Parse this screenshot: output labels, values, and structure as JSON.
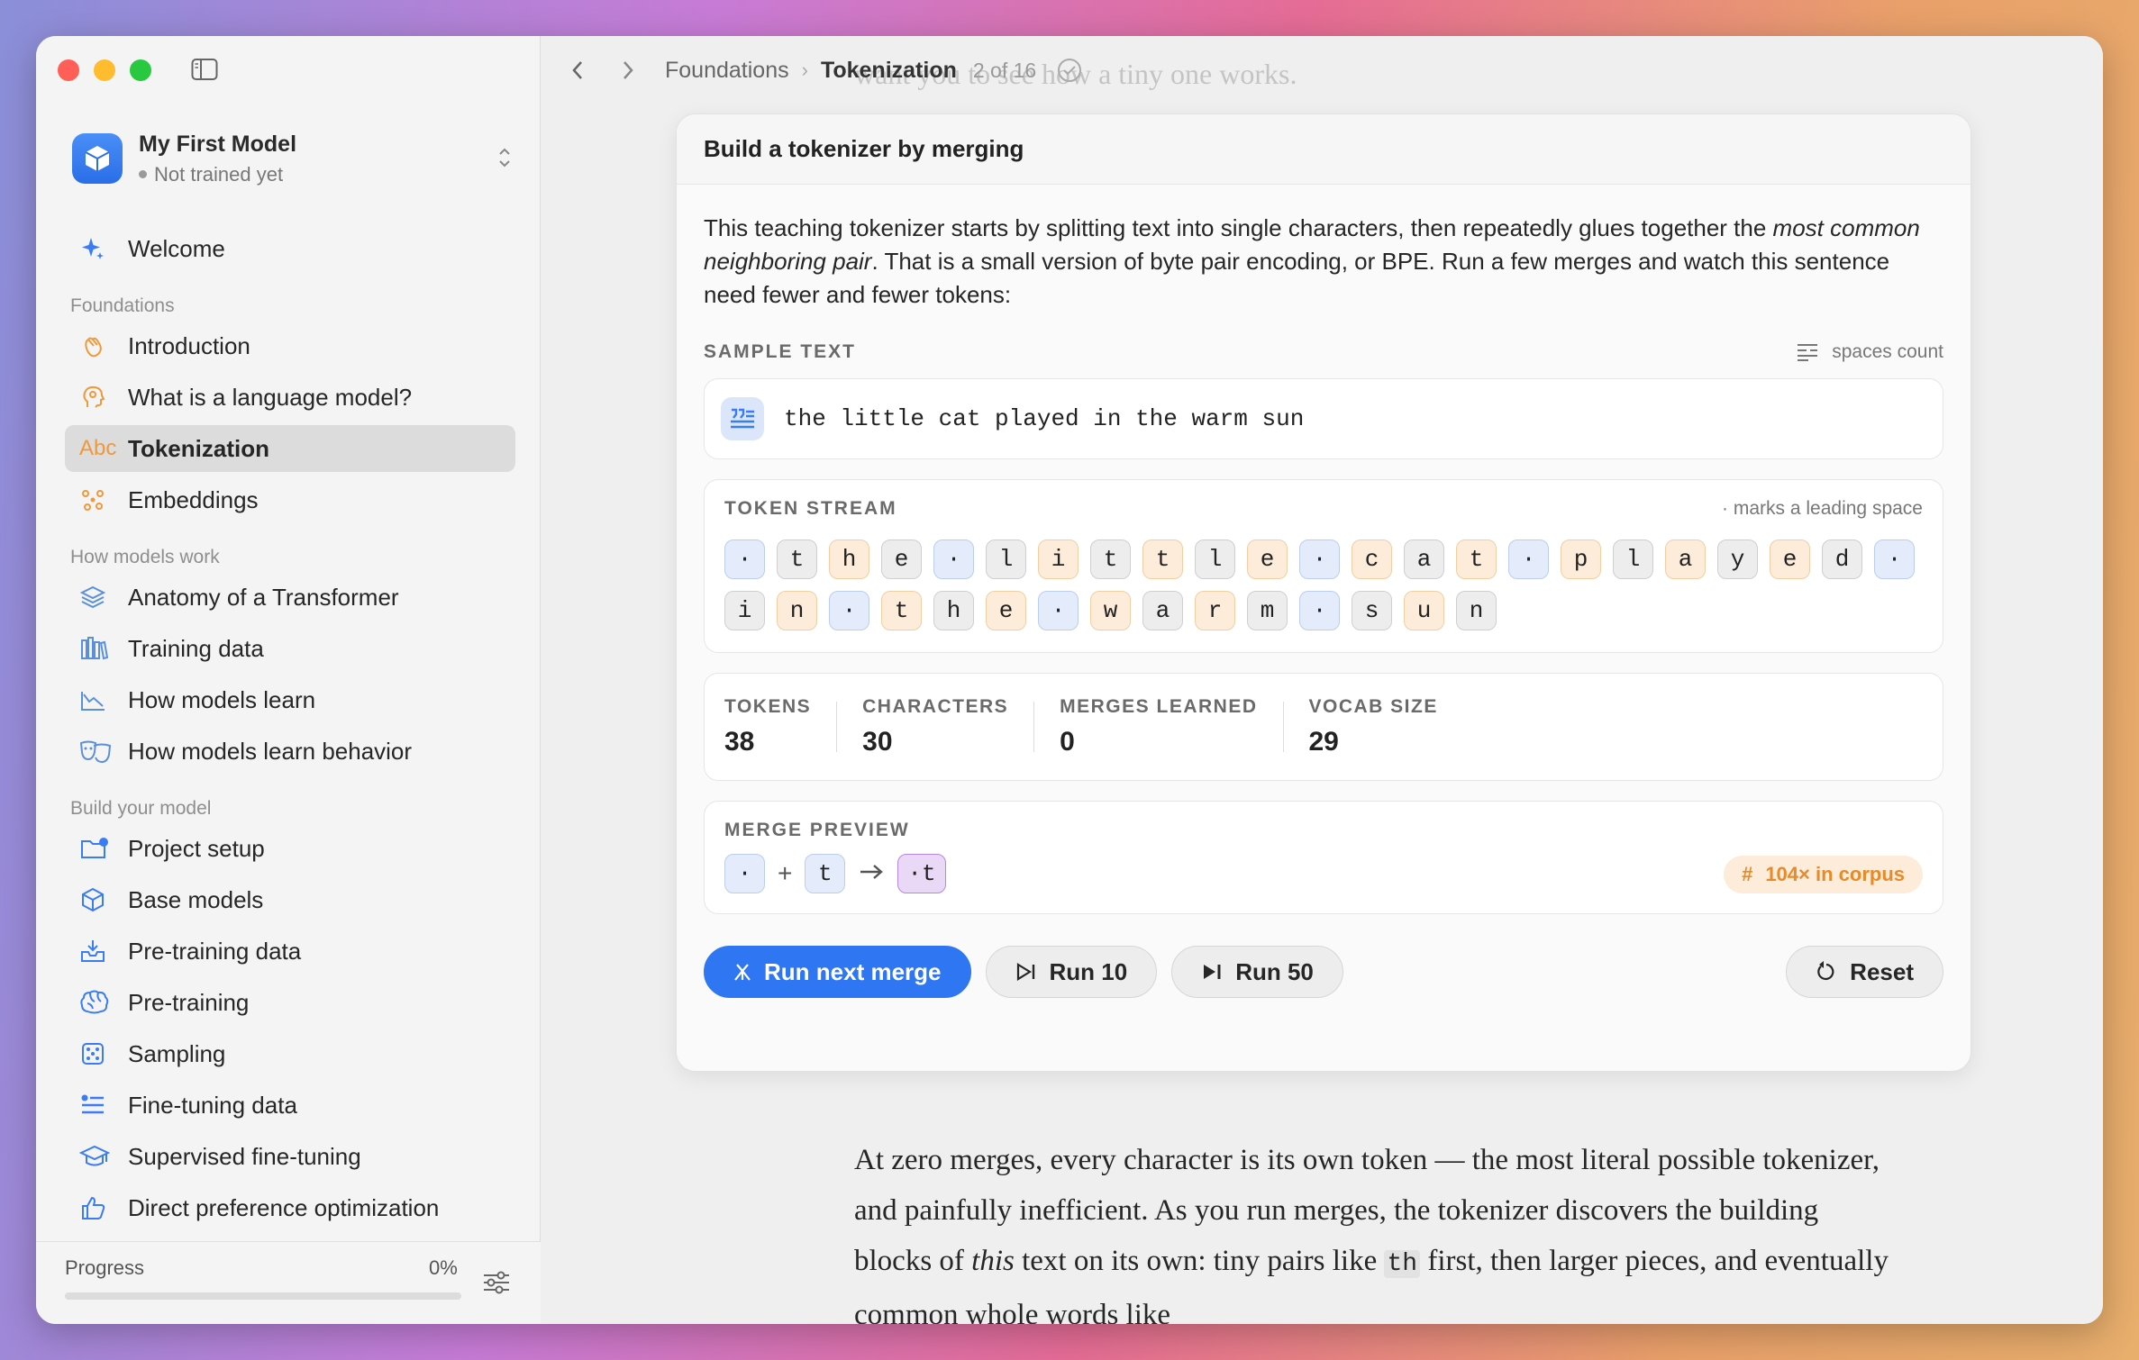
{
  "project": {
    "name": "My First Model",
    "status": "Not trained yet"
  },
  "sidebar": {
    "welcome": "Welcome",
    "sections": [
      {
        "label": "Foundations",
        "items": [
          {
            "label": "Introduction",
            "icon": "wave-hand-icon"
          },
          {
            "label": "What is a language model?",
            "icon": "head-icon"
          },
          {
            "label": "Tokenization",
            "icon": "abc-icon",
            "active": true
          },
          {
            "label": "Embeddings",
            "icon": "nodes-icon"
          }
        ]
      },
      {
        "label": "How models work",
        "items": [
          {
            "label": "Anatomy of a Transformer",
            "icon": "layers-icon"
          },
          {
            "label": "Training data",
            "icon": "books-icon"
          },
          {
            "label": "How models learn",
            "icon": "chart-down-icon"
          },
          {
            "label": "How models learn behavior",
            "icon": "masks-icon"
          }
        ]
      },
      {
        "label": "Build your model",
        "items": [
          {
            "label": "Project setup",
            "icon": "folder-gear-icon"
          },
          {
            "label": "Base models",
            "icon": "cube-icon"
          },
          {
            "label": "Pre-training data",
            "icon": "tray-download-icon"
          },
          {
            "label": "Pre-training",
            "icon": "brain-icon"
          },
          {
            "label": "Sampling",
            "icon": "dice-icon"
          },
          {
            "label": "Fine-tuning data",
            "icon": "checklist-icon"
          },
          {
            "label": "Supervised fine-tuning",
            "icon": "graduation-cap-icon"
          },
          {
            "label": "Direct preference optimization",
            "icon": "thumbs-up-icon"
          }
        ]
      }
    ],
    "progress_label": "Progress",
    "progress_pct_text": "0%",
    "progress_value": 0
  },
  "breadcrumb": {
    "parent": "Foundations",
    "current": "Tokenization",
    "count": "2 of 16"
  },
  "faded_top_text": "want you to see how a tiny one works.",
  "card": {
    "title": "Build a tokenizer by merging",
    "intro_1": "This teaching tokenizer starts by splitting text into single characters, then repeatedly glues together the ",
    "intro_em": "most common neighboring pair",
    "intro_2": ". That is a small version of byte pair encoding, or BPE. Run a few merges and watch this sentence need fewer and fewer tokens:",
    "sample_label": "SAMPLE TEXT",
    "sample_aside": "spaces count",
    "sample_text": "the little cat played in the warm sun",
    "stream_label": "TOKEN STREAM",
    "stream_aside": "· marks a leading space",
    "tokens": [
      {
        "t": "·",
        "k": "space"
      },
      {
        "t": "t",
        "k": "grey"
      },
      {
        "t": "h",
        "k": "orange"
      },
      {
        "t": "e",
        "k": "grey"
      },
      {
        "t": "·",
        "k": "space"
      },
      {
        "t": "l",
        "k": "grey"
      },
      {
        "t": "i",
        "k": "orange"
      },
      {
        "t": "t",
        "k": "grey"
      },
      {
        "t": "t",
        "k": "orange"
      },
      {
        "t": "l",
        "k": "grey"
      },
      {
        "t": "e",
        "k": "orange"
      },
      {
        "t": "·",
        "k": "space"
      },
      {
        "t": "c",
        "k": "orange"
      },
      {
        "t": "a",
        "k": "grey"
      },
      {
        "t": "t",
        "k": "orange"
      },
      {
        "t": "·",
        "k": "space"
      },
      {
        "t": "p",
        "k": "orange"
      },
      {
        "t": "l",
        "k": "grey"
      },
      {
        "t": "a",
        "k": "orange"
      },
      {
        "t": "y",
        "k": "grey"
      },
      {
        "t": "e",
        "k": "orange"
      },
      {
        "t": "d",
        "k": "grey"
      },
      {
        "t": "·",
        "k": "space"
      },
      {
        "t": "i",
        "k": "grey"
      },
      {
        "t": "n",
        "k": "orange"
      },
      {
        "t": "·",
        "k": "space"
      },
      {
        "t": "t",
        "k": "orange"
      },
      {
        "t": "h",
        "k": "grey"
      },
      {
        "t": "e",
        "k": "orange"
      },
      {
        "t": "·",
        "k": "space"
      },
      {
        "t": "w",
        "k": "orange"
      },
      {
        "t": "a",
        "k": "grey"
      },
      {
        "t": "r",
        "k": "orange"
      },
      {
        "t": "m",
        "k": "grey"
      },
      {
        "t": "·",
        "k": "space"
      },
      {
        "t": "s",
        "k": "grey"
      },
      {
        "t": "u",
        "k": "orange"
      },
      {
        "t": "n",
        "k": "grey"
      }
    ],
    "stats": [
      {
        "label": "TOKENS",
        "value": "38"
      },
      {
        "label": "CHARACTERS",
        "value": "30"
      },
      {
        "label": "MERGES LEARNED",
        "value": "0"
      },
      {
        "label": "VOCAB SIZE",
        "value": "29"
      }
    ],
    "merge_label": "MERGE PREVIEW",
    "merge_left": "·",
    "merge_plus": "+",
    "merge_right": "t",
    "merge_result": "·t",
    "corpus_badge": "104× in corpus",
    "corpus_hash": "#",
    "buttons": {
      "run_next": "Run next merge",
      "run10": "Run 10",
      "run50": "Run 50",
      "reset": "Reset"
    }
  },
  "article": {
    "p1": "At zero merges, every character is its own token — the most literal possible tokenizer, and painfully inefficient. As you run merges, the tokenizer discovers the building blocks of ",
    "p1_em": "this",
    "p1_b": " text on its own: tiny pairs like ",
    "p1_code": "th",
    "p1_c": " first, then larger pieces, and eventually common whole words like"
  },
  "colors": {
    "accent": "#2f76f2",
    "space_token": "#e4ecfb",
    "orange_token": "#fcecd9",
    "merged_token": "#ead8f7",
    "badge_text": "#e68a2a"
  }
}
